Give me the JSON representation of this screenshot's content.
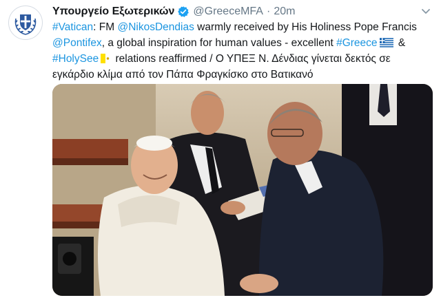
{
  "account": {
    "name": "Υπουργείο Εξωτερικών",
    "handle": "@GreeceMFA",
    "separator": "·",
    "time": "20m"
  },
  "tweet": {
    "line1": {
      "hashtag_vatican": "#Vatican",
      "t1": ": FM ",
      "mention_dendias": "@NikosDendias",
      "t2": " warmly received by His Holiness Pope Francis"
    },
    "line2": {
      "mention_pontifex": "@Pontifex",
      "t1": ", a global inspiration for human values - excellent ",
      "hashtag_greece": "#Greece",
      "t2": " & "
    },
    "line3": {
      "hashtag_holysee": "#HolySee",
      "t1": " relations reaffirmed / Ο ΥΠΕΞ Ν. Δένδιας γίνεται δεκτός σε"
    },
    "line4": {
      "t1": "εγκάρδιο κλίμα από τον Πάπα Φραγκίσκο στο Βατικανό"
    }
  },
  "icons": {
    "verified": "verified-badge-icon",
    "menu": "chevron-down-icon",
    "greece_flag": "greece-flag-icon",
    "vatican_flag": "vatican-flag-icon",
    "avatar": "greek-coat-of-arms-icon"
  },
  "colors": {
    "link": "#1b95e0",
    "secondary_text": "#657786",
    "verified": "#1da1f2"
  }
}
